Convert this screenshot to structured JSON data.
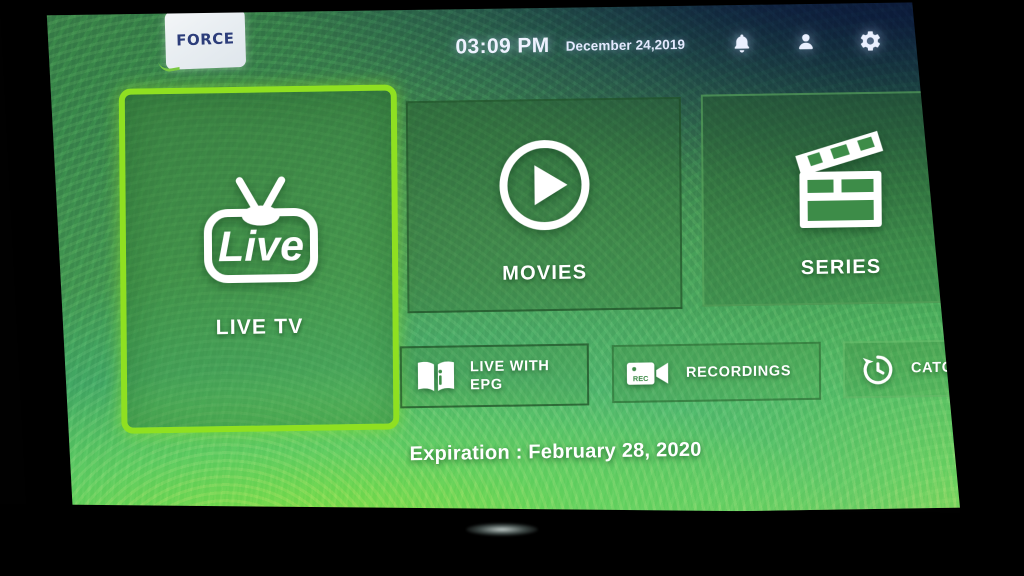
{
  "app": {
    "logo_text": "FORCE"
  },
  "topbar": {
    "time": "03:09 PM",
    "date": "December 24,2019",
    "icons": [
      {
        "name": "notifications-icon",
        "label": "bell-icon"
      },
      {
        "name": "account-icon",
        "label": "user-icon"
      },
      {
        "name": "settings-icon",
        "label": "gear-icon"
      },
      {
        "name": "power-icon",
        "label": "power-icon"
      }
    ]
  },
  "tiles": [
    {
      "id": "live-tv",
      "label": "LIVE TV",
      "icon": "tv-live-icon",
      "focused": true
    },
    {
      "id": "movies",
      "label": "MOVIES",
      "icon": "play-circle-icon",
      "focused": false
    },
    {
      "id": "series",
      "label": "SERIES",
      "icon": "clapperboard-icon",
      "focused": false
    }
  ],
  "buttons": [
    {
      "id": "live-with-epg",
      "label": "LIVE WITH EPG",
      "line1": "LIVE WITH",
      "line2": "EPG",
      "icon": "book-info-icon"
    },
    {
      "id": "recordings",
      "label": "RECORDINGS",
      "icon": "video-camera-rec-icon",
      "icon_text": "REC"
    },
    {
      "id": "catch-up",
      "label": "CATCH UP",
      "icon": "clock-history-icon"
    }
  ],
  "footer": {
    "expiration": "Expiration : February 28, 2020"
  },
  "colors": {
    "focus_border": "#8fe021",
    "tile_text": "#ffffff",
    "accent_green": "#4aa255",
    "topbar_text": "#eef2ff"
  }
}
